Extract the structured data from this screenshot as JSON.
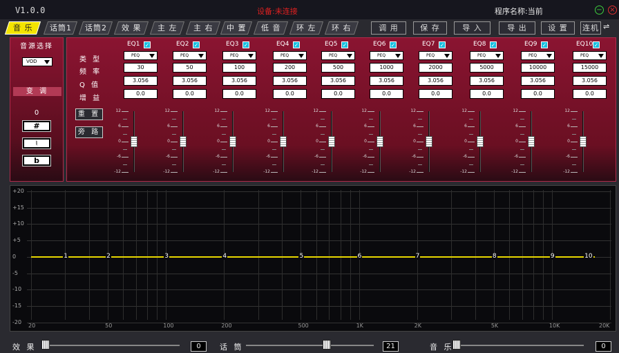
{
  "titlebar": {
    "version": "V1.0.0",
    "status": "设备:未连接",
    "program": "程序名称:当前"
  },
  "tabs": {
    "sections": [
      "音 乐",
      "话筒1",
      "话筒2",
      "效 果",
      "主 左",
      "主 右",
      "中 置",
      "低 音",
      "环 左",
      "环 右"
    ],
    "actions": [
      "调 用",
      "保 存",
      "导 入",
      "导 出",
      "设 置",
      "连机"
    ]
  },
  "left_panel": {
    "source_title": "音源选择",
    "source_value": "VOD",
    "transpose_label": "变 调",
    "transpose_value": "0",
    "buttons": [
      "#",
      "♮",
      "b"
    ]
  },
  "eq_panel": {
    "param_labels": [
      "类 型",
      "频 率",
      "Q 值",
      "增 益"
    ],
    "reset_button": "重 置",
    "bypass_button": "旁 路",
    "slider_ticks": [
      "12",
      "6",
      "0",
      "-6",
      "-12"
    ],
    "bands": [
      {
        "name": "EQ1",
        "type": "PEQ",
        "freq": "30",
        "q": "3.056",
        "gain": "0.0",
        "enabled": true
      },
      {
        "name": "EQ2",
        "type": "PEQ",
        "freq": "50",
        "q": "3.056",
        "gain": "0.0",
        "enabled": true
      },
      {
        "name": "EQ3",
        "type": "PEQ",
        "freq": "100",
        "q": "3.056",
        "gain": "0.0",
        "enabled": true
      },
      {
        "name": "EQ4",
        "type": "PEQ",
        "freq": "200",
        "q": "3.056",
        "gain": "0.0",
        "enabled": true
      },
      {
        "name": "EQ5",
        "type": "PEQ",
        "freq": "500",
        "q": "3.056",
        "gain": "0.0",
        "enabled": true
      },
      {
        "name": "EQ6",
        "type": "PEQ",
        "freq": "1000",
        "q": "3.056",
        "gain": "0.0",
        "enabled": true
      },
      {
        "name": "EQ7",
        "type": "PEQ",
        "freq": "2000",
        "q": "3.056",
        "gain": "0.0",
        "enabled": true
      },
      {
        "name": "EQ8",
        "type": "PEQ",
        "freq": "5000",
        "q": "3.056",
        "gain": "0.0",
        "enabled": true
      },
      {
        "name": "EQ9",
        "type": "PEQ",
        "freq": "10000",
        "q": "3.056",
        "gain": "0.0",
        "enabled": true
      },
      {
        "name": "EQ10",
        "type": "PEQ",
        "freq": "15000",
        "q": "3.056",
        "gain": "0.0",
        "enabled": true
      }
    ]
  },
  "graph": {
    "y_labels": [
      "+20",
      "+15",
      "+10",
      "+5",
      "0",
      "-5",
      "-10",
      "-15",
      "-20"
    ],
    "x_labels": [
      "20",
      "50",
      "100",
      "200",
      "500",
      "1K",
      "2K",
      "5K",
      "10K",
      "20K"
    ],
    "point_labels": [
      "1",
      "2",
      "3",
      "4",
      "5",
      "6",
      "7",
      "8",
      "9",
      "10"
    ]
  },
  "bottom": {
    "effect_label": "效 果",
    "effect_value": "0",
    "effect_level": 0,
    "mic_label": "话 筒",
    "mic_value": "21",
    "mic_level": 0.6,
    "music_label": "音 乐",
    "music_value": "0",
    "music_level": 0
  },
  "colors": {
    "accent": "#f4e400",
    "panel": "#8a1431",
    "curve": "#e8d800",
    "checkbox": "#18c0e0"
  }
}
